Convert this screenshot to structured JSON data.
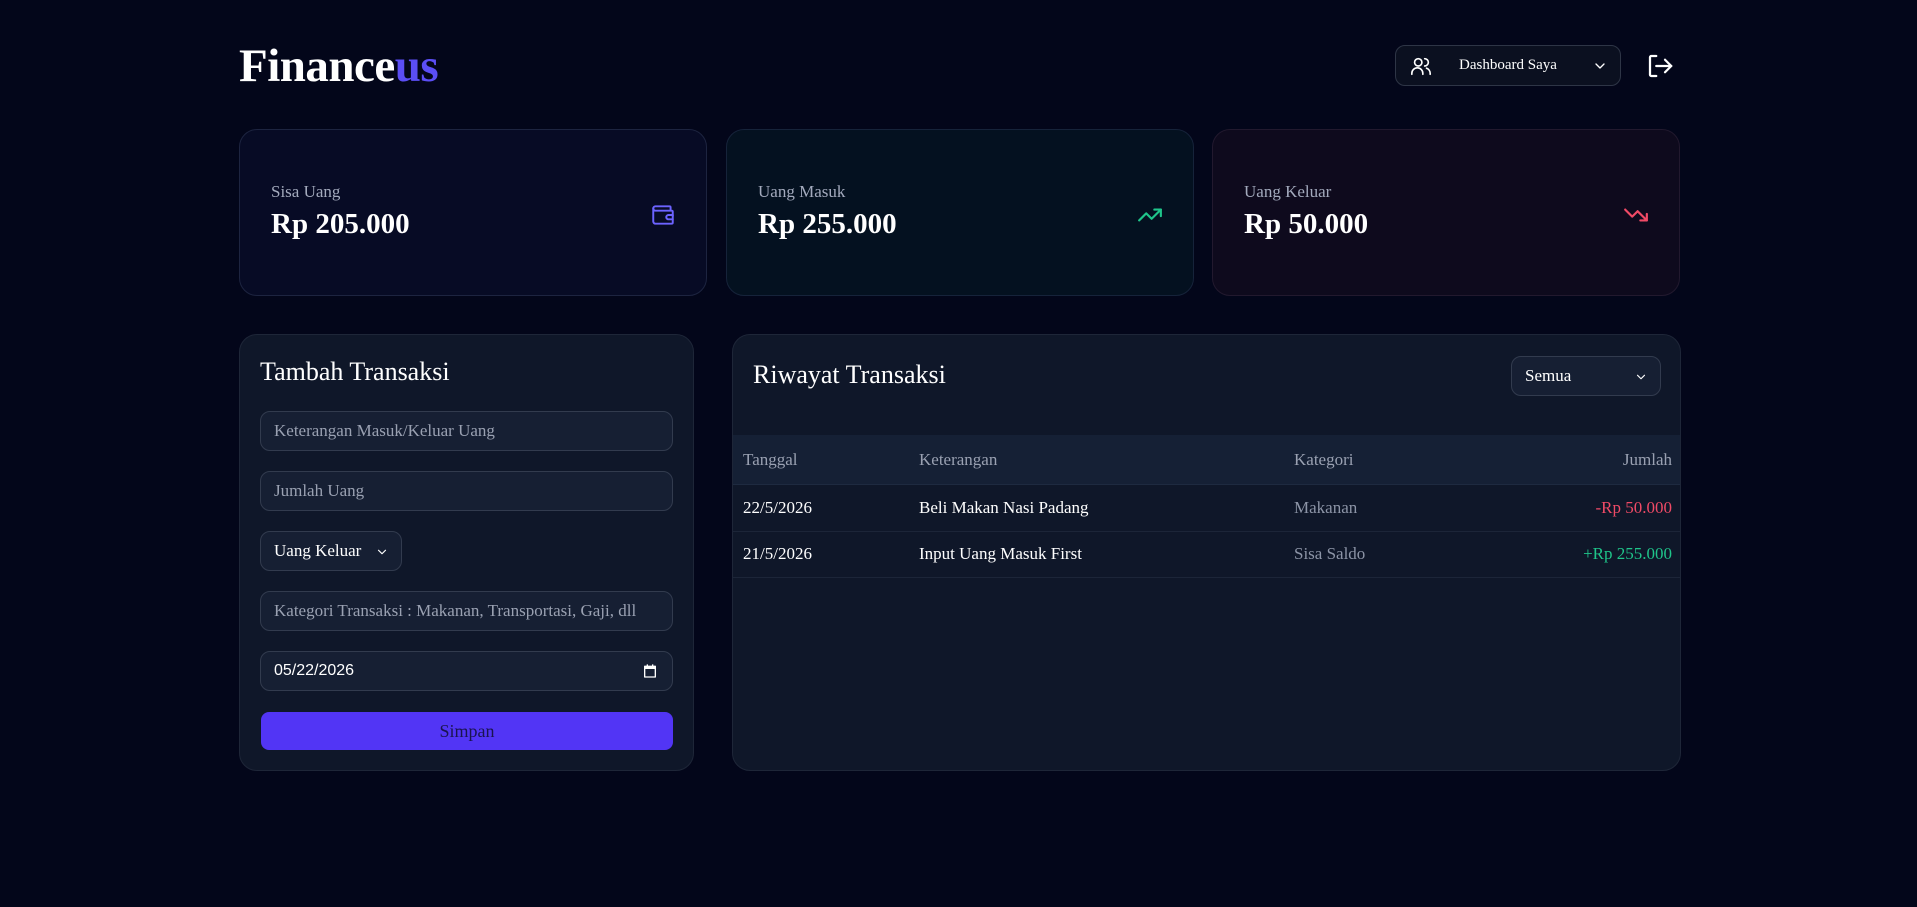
{
  "app": {
    "logo_main": "Finance",
    "logo_accent": "us"
  },
  "header": {
    "dashboard_select": "Dashboard Saya"
  },
  "summary": {
    "balance": {
      "title": "Sisa Uang",
      "value": "Rp 205.000",
      "icon": "wallet-icon",
      "color": "#6c63ff"
    },
    "income": {
      "title": "Uang Masuk",
      "value": "Rp 255.000",
      "icon": "trending-up-icon",
      "color": "#1fc58a"
    },
    "expense": {
      "title": "Uang Keluar",
      "value": "Rp 50.000",
      "icon": "trending-down-icon",
      "color": "#f04a66"
    }
  },
  "form": {
    "title": "Tambah Transaksi",
    "description_placeholder": "Keterangan Masuk/Keluar Uang",
    "amount_placeholder": "Jumlah Uang",
    "type_value": "Uang Keluar",
    "category_placeholder": "Kategori Transaksi : Makanan, Transportasi, Gaji, dll",
    "date_value": "05/22/2026",
    "save_label": "Simpan"
  },
  "history": {
    "title": "Riwayat Transaksi",
    "filter_value": "Semua",
    "columns": [
      "Tanggal",
      "Keterangan",
      "Kategori",
      "Jumlah"
    ],
    "rows": [
      {
        "date": "22/5/2026",
        "description": "Beli Makan Nasi Padang",
        "category": "Makanan",
        "amount": "-Rp 50.000",
        "type": "expense"
      },
      {
        "date": "21/5/2026",
        "description": "Input Uang Masuk First",
        "category": "Sisa Saldo",
        "amount": "+Rp 255.000",
        "type": "income"
      }
    ]
  }
}
